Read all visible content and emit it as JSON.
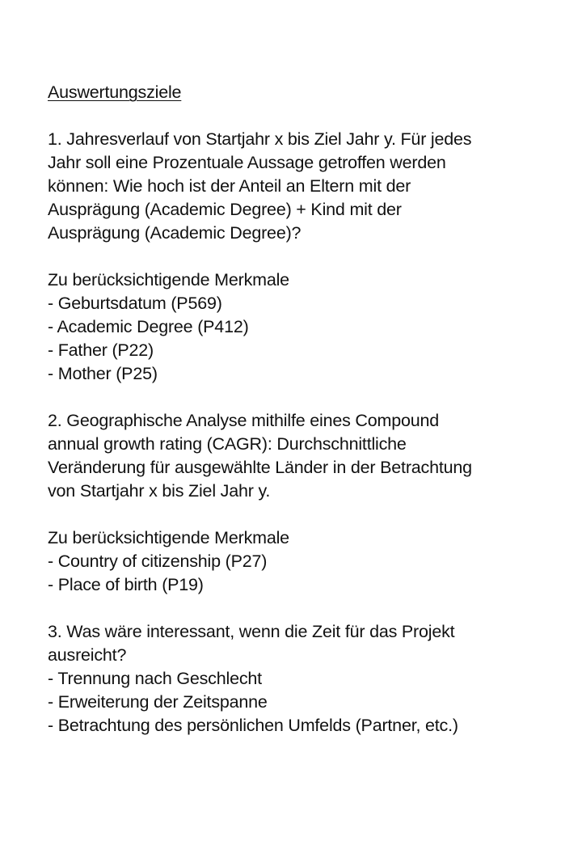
{
  "title": "Auswertungsziele",
  "goal1": {
    "lines": [
      "1. Jahresverlauf von Startjahr x bis Ziel Jahr y. Für jedes",
      "Jahr soll eine Prozentuale Aussage getroffen werden",
      "können: Wie hoch ist der Anteil an Eltern mit der",
      "Ausprägung (Academic Degree) + Kind mit der",
      "Ausprägung (Academic Degree)?"
    ],
    "features_heading": "Zu berücksichtigende Merkmale",
    "features": [
      "- Geburtsdatum (P569)",
      "- Academic Degree (P412)",
      "- Father (P22)",
      "- Mother (P25)"
    ]
  },
  "goal2": {
    "lines": [
      "2. Geographische Analyse mithilfe eines Compound",
      "annual growth rating (CAGR): Durchschnittliche",
      "Veränderung für ausgewählte Länder in der Betrachtung",
      "von Startjahr x bis Ziel Jahr y."
    ],
    "features_heading": "Zu berücksichtigende Merkmale",
    "features": [
      "- Country of citizenship (P27)",
      "- Place of birth (P19)"
    ]
  },
  "goal3": {
    "lines": [
      "3. Was wäre interessant, wenn die Zeit für das Projekt",
      "ausreicht?"
    ],
    "items": [
      "- Trennung nach Geschlecht",
      "- Erweiterung der Zeitspanne",
      "- Betrachtung des persönlichen Umfelds (Partner, etc.)"
    ]
  }
}
